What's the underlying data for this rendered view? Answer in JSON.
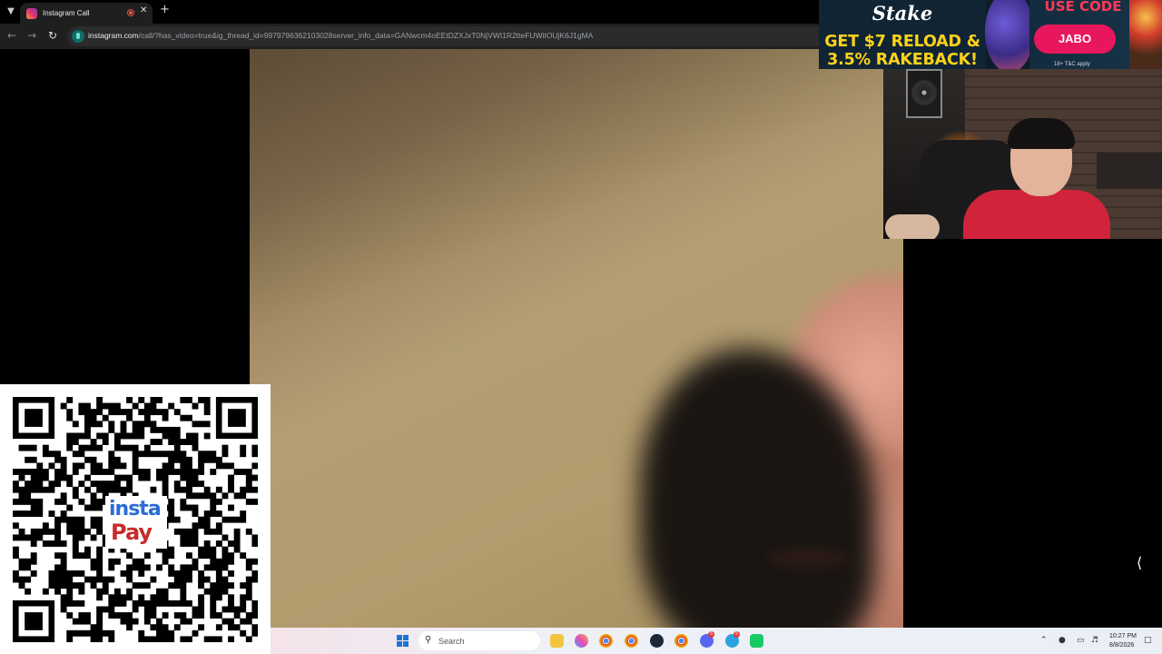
{
  "browser": {
    "tab_title": "Instagram Call",
    "url_host": "instagram.com",
    "url_path": "/call/?has_video=true&ig_thread_id=9979796362103028server_info_data=GANwcm4oEEtDZXJxT0NjVWI1R2tteFUWitOUjK6J1gMA"
  },
  "ad": {
    "brand": "Stake",
    "headline_line1": "GET $7 RELOAD &",
    "headline_line2": "3.5% RAKEBACK!",
    "use_code_label": "USE CODE",
    "promo_code": "JABO",
    "terms": "18+ T&C apply"
  },
  "qr": {
    "logo_line1": "insta",
    "logo_line2": "Pay"
  },
  "taskbar": {
    "search_placeholder": "Search",
    "time": "10:27 PM",
    "date": "8/8/2026",
    "discord_badge": "5",
    "telegram_badge": "5"
  },
  "colors": {
    "stake_yellow": "#ffd21a",
    "stake_pink": "#e8175d",
    "instapay_blue": "#2a6cd6",
    "instapay_red": "#c92a2a"
  }
}
